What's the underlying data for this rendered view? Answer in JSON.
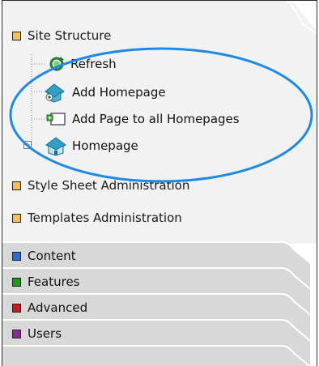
{
  "sections": {
    "site_structure": {
      "label": "Site Structure",
      "color": "#f4c05a"
    },
    "stylesheet": {
      "label": "Style Sheet Administration",
      "color": "#f4c05a"
    },
    "templates": {
      "label": "Templates Administration",
      "color": "#f4c05a"
    }
  },
  "tree": {
    "items": [
      {
        "label": "Refresh",
        "icon": "refresh-icon"
      },
      {
        "label": "Add Homepage",
        "icon": "house-add-icon"
      },
      {
        "label": "Add Page to all Homepages",
        "icon": "page-add-icon"
      },
      {
        "label": "Homepage",
        "icon": "house-icon"
      }
    ],
    "expand_symbol": "+"
  },
  "tabs": [
    {
      "label": "Content",
      "color": "#2a6fd0"
    },
    {
      "label": "Features",
      "color": "#1c9a1c"
    },
    {
      "label": "Advanced",
      "color": "#cc1a1a"
    },
    {
      "label": "Users",
      "color": "#8a2a9a"
    }
  ],
  "colors": {
    "highlight_ellipse": "#1e8ae8",
    "panel_bg": "#f2f2f2",
    "tab_bg": "#d8d8d8"
  }
}
